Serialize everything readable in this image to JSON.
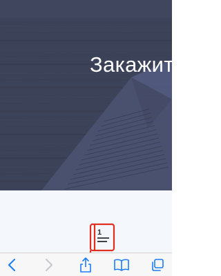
{
  "hero": {
    "title": "Закажите",
    "background_color": "#40465c",
    "text_color": "#ffffff"
  },
  "page": {
    "body_color": "#f4f7fb",
    "feature_icon": "book-step-one-icon",
    "icon_accent_color": "#e02f1f"
  },
  "toolbar": {
    "background_color": "#f7f7f8",
    "accent_color": "#1a7cf5",
    "disabled_color": "#c6c6cc",
    "items": [
      {
        "icon": "chevron-left-icon",
        "enabled": true
      },
      {
        "icon": "chevron-right-icon",
        "enabled": false
      },
      {
        "icon": "share-icon",
        "enabled": true
      },
      {
        "icon": "bookmarks-icon",
        "enabled": true
      },
      {
        "icon": "tabs-icon",
        "enabled": true
      }
    ]
  }
}
